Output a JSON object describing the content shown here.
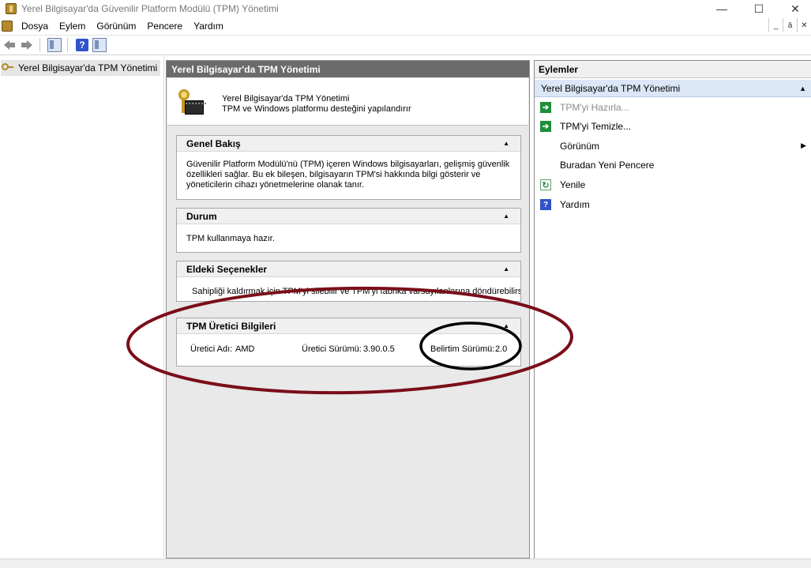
{
  "window": {
    "title": "Yerel Bilgisayar'da Güvenilir Platform Modülü (TPM) Yönetimi",
    "minimize": "—",
    "maximize": "☐",
    "close": "✕"
  },
  "menu": {
    "items": [
      "Dosya",
      "Eylem",
      "Görünüm",
      "Pencere",
      "Yardım"
    ],
    "mdi_min": "_",
    "mdi_restore": "ā",
    "mdi_close": "✕"
  },
  "tree": {
    "root_label": "Yerel Bilgisayar'da TPM Yönetimi"
  },
  "center": {
    "header": "Yerel Bilgisayar'da TPM Yönetimi",
    "banner_line1": "Yerel Bilgisayar'da TPM Yönetimi",
    "banner_line2": "TPM ve Windows platformu desteğini yapılandırır",
    "panels": {
      "overview": {
        "title": "Genel Bakış",
        "body": "Güvenilir Platform Modülü'nü (TPM) içeren Windows bilgisayarları, gelişmiş güvenlik özellikleri sağlar. Bu ek bileşen, bilgisayarın TPM'si hakkında bilgi gösterir ve yöneticilerin cihazı yönetmelerine olanak tanır."
      },
      "status": {
        "title": "Durum",
        "body": "TPM kullanmaya hazır."
      },
      "options": {
        "title": "Eldeki Seçenekler",
        "body": "Sahipliği kaldırmak için TPM'yi silebilir ve TPM'yi fabrika varsayılanlarına döndürebilirsiniz."
      },
      "manufacturer": {
        "title": "TPM Üretici Bilgileri",
        "maker_label": "Üretici Adı:",
        "maker_value": "AMD",
        "version_label": "Üretici Sürümü:",
        "version_value": "3.90.0.5",
        "spec_label": "Belirtim Sürümü:",
        "spec_value": "2.0"
      }
    },
    "caret": "▲"
  },
  "actions": {
    "header": "Eylemler",
    "section": "Yerel Bilgisayar'da TPM Yönetimi",
    "items": [
      {
        "label": "TPM'yi Hazırla...",
        "icon": "green-arrow-icon"
      },
      {
        "label": "TPM'yi Temizle...",
        "icon": "green-arrow-icon"
      },
      {
        "label": "Görünüm",
        "icon": "none"
      },
      {
        "label": "Buradan Yeni Pencere",
        "icon": "none"
      },
      {
        "label": "Yenile",
        "icon": "refresh-icon"
      },
      {
        "label": "Yardım",
        "icon": "help-icon"
      }
    ],
    "submenu_arrow": "▶",
    "caret": "▲"
  },
  "colors": {
    "annotation_red": "#7a0e1a",
    "annotation_black": "#000000",
    "header_gray": "#6b6b6b",
    "action_green": "#1e8f3a"
  }
}
